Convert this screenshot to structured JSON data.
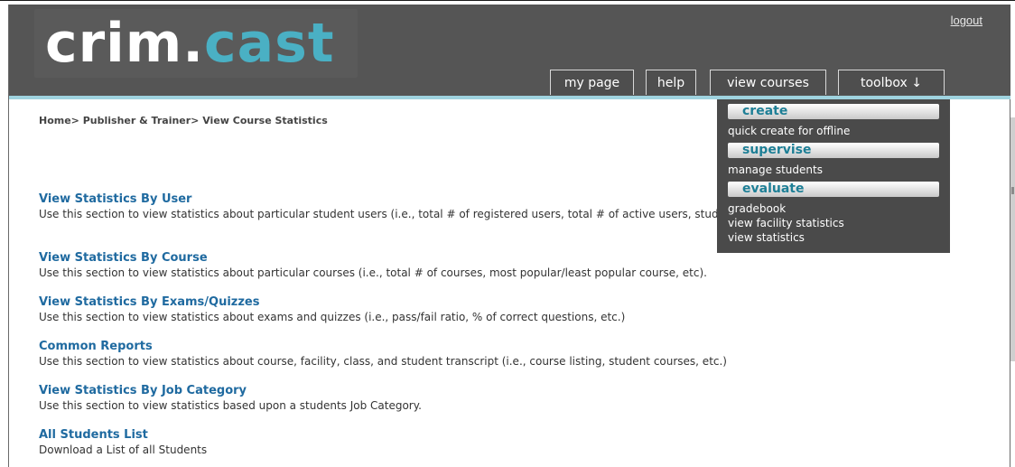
{
  "app": {
    "logo_part1": "crim.",
    "logo_part2": "cast",
    "logout_label": "logout"
  },
  "nav": {
    "tabs": [
      {
        "label": "my page"
      },
      {
        "label": "help"
      },
      {
        "label": "view courses"
      },
      {
        "label": "toolbox ↓"
      }
    ]
  },
  "toolbox_menu": {
    "sections": [
      {
        "label": "create",
        "items": [
          "quick create for offline"
        ]
      },
      {
        "label": "supervise",
        "items": [
          "manage students"
        ]
      },
      {
        "label": "evaluate",
        "items": [
          "gradebook",
          "view facility statistics",
          "view statistics"
        ]
      }
    ]
  },
  "breadcrumb": "Home> Publisher & Trainer> View Course Statistics",
  "sections": [
    {
      "title": "View Statistics By User",
      "description": "Use this section to view statistics about particular student users (i.e., total # of registered users, total # of active users, students enrolled in a course, etc)."
    },
    {
      "title": "View Statistics By Course",
      "description": "Use this section to view statistics about particular courses (i.e., total # of courses, most popular/least popular course, etc)."
    },
    {
      "title": "View Statistics By Exams/Quizzes",
      "description": "Use this section to view statistics about exams and quizzes (i.e., pass/fail ratio, % of correct questions, etc.)"
    },
    {
      "title": "Common Reports",
      "description": "Use this section to view statistics about course, facility, class, and student transcript (i.e., course listing, student courses, etc.)"
    },
    {
      "title": "View Statistics By Job Category",
      "description": "Use this section to view statistics based upon a students Job Category."
    },
    {
      "title": "All Students List",
      "description": "Download a List of all Students"
    }
  ],
  "colors": {
    "header_bg": "#555555",
    "accent_stripe": "#9fd3df",
    "link_blue": "#1f6aa0",
    "menu_section_text": "#1e7f96"
  }
}
